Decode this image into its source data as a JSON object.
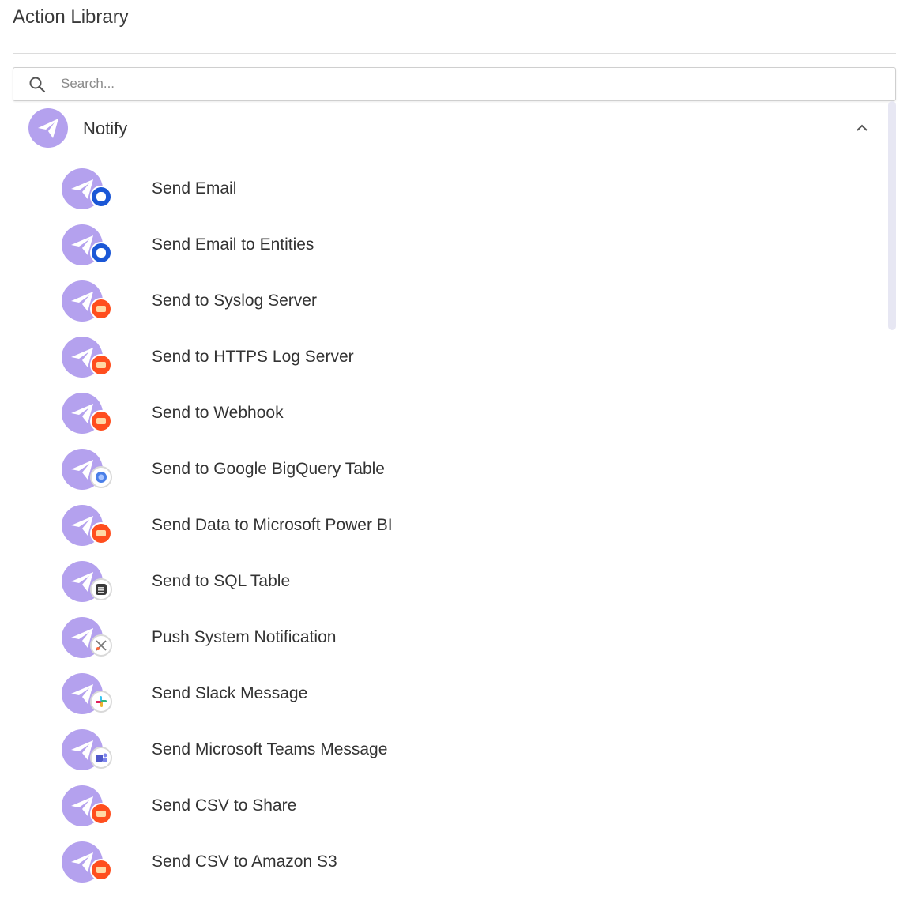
{
  "header": {
    "title": "Action Library"
  },
  "search": {
    "placeholder": "Search..."
  },
  "group": {
    "label": "Notify",
    "icon": "paper-plane-icon",
    "expanded": true
  },
  "colors": {
    "accent": "#b4a1ee",
    "badge_blue": "#1b57d6",
    "badge_orange": "#ff4e1e"
  },
  "actions": [
    {
      "label": "Send Email",
      "badge": "email-icon",
      "badge_style": "blue"
    },
    {
      "label": "Send Email to Entities",
      "badge": "email-icon",
      "badge_style": "blue"
    },
    {
      "label": "Send to Syslog Server",
      "badge": "server-icon",
      "badge_style": "orange"
    },
    {
      "label": "Send to HTTPS Log Server",
      "badge": "server-icon",
      "badge_style": "orange"
    },
    {
      "label": "Send to Webhook",
      "badge": "server-icon",
      "badge_style": "orange"
    },
    {
      "label": "Send to Google BigQuery Table",
      "badge": "bigquery-icon",
      "badge_style": "bigquery"
    },
    {
      "label": "Send Data to Microsoft Power BI",
      "badge": "server-icon",
      "badge_style": "orange"
    },
    {
      "label": "Send to SQL Table",
      "badge": "sql-icon",
      "badge_style": "sql"
    },
    {
      "label": "Push System Notification",
      "badge": "system-icon",
      "badge_style": "system"
    },
    {
      "label": "Send Slack Message",
      "badge": "slack-icon",
      "badge_style": "slack"
    },
    {
      "label": "Send Microsoft Teams Message",
      "badge": "teams-icon",
      "badge_style": "teams"
    },
    {
      "label": "Send CSV to Share",
      "badge": "server-icon",
      "badge_style": "orange"
    },
    {
      "label": "Send CSV to Amazon S3",
      "badge": "server-icon",
      "badge_style": "orange"
    }
  ]
}
